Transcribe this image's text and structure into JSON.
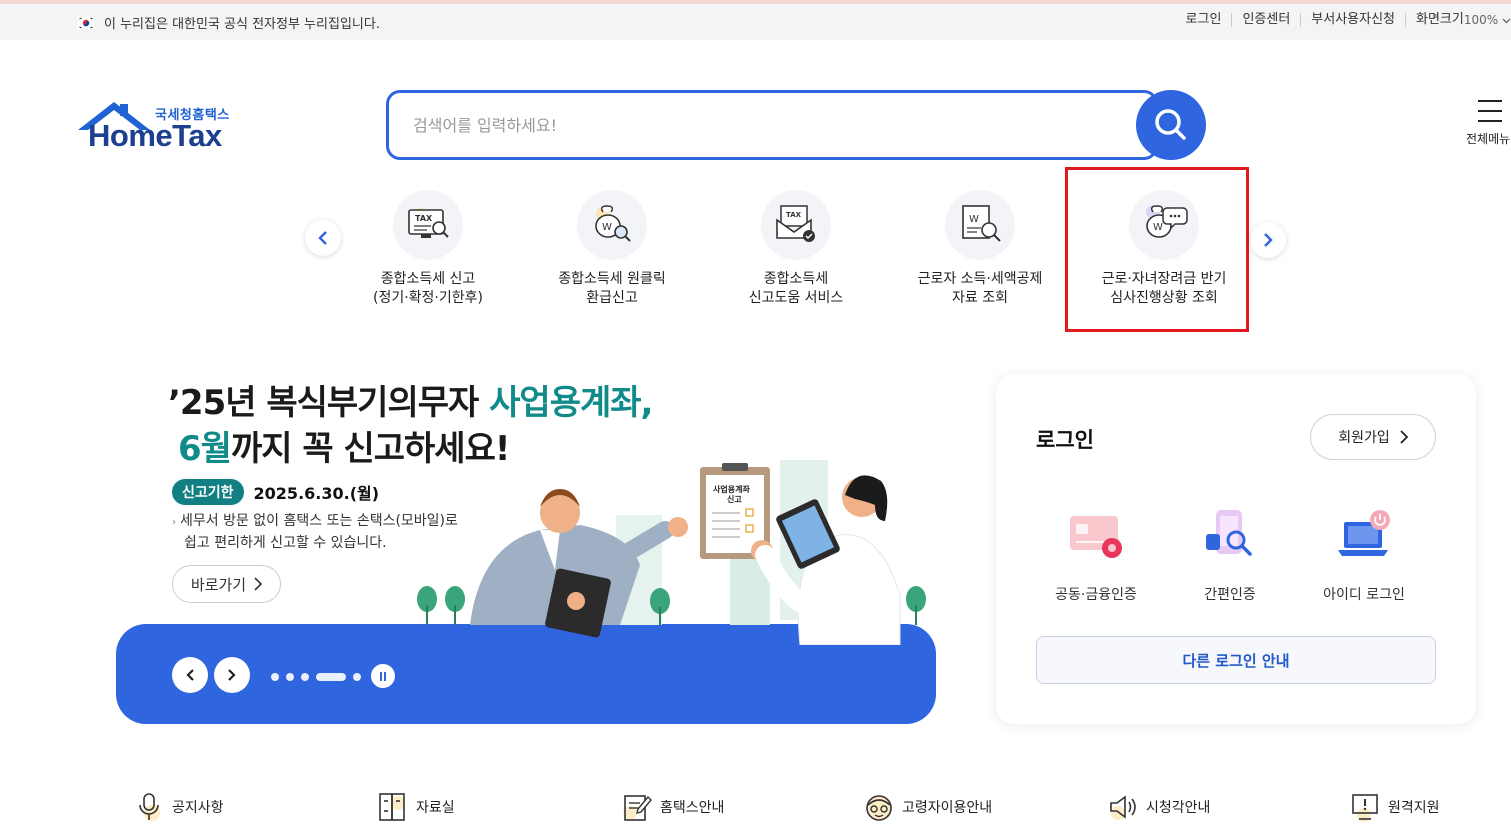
{
  "gov_banner": {
    "flag_icon": "korean-flag-icon",
    "text": "이 누리집은 대한민국 공식 전자정부 누리집입니다.",
    "links": [
      "로그인",
      "인증센터",
      "부서사용자신청",
      "화면크기"
    ],
    "zoom": "100%"
  },
  "logo": {
    "sub": "국세청홈택스",
    "main": "HomeTax"
  },
  "search": {
    "placeholder": "검색어를 입력하세요!",
    "button_icon": "search-icon"
  },
  "all_menu": {
    "label": "전체메뉴"
  },
  "quick_menu": {
    "items": [
      {
        "label": "종합소득세 신고\n(정기·확정·기한후)",
        "icon": "tax-monitor-icon"
      },
      {
        "label": "종합소득세 원클릭\n환급신고",
        "icon": "money-bag-search-icon"
      },
      {
        "label": "종합소득세\n신고도움 서비스",
        "icon": "tax-envelope-check-icon"
      },
      {
        "label": "근로자 소득·세액공제\n자료 조회",
        "icon": "document-search-icon"
      },
      {
        "label": "근로·자녀장려금 반기\n심사진행상황 조회",
        "icon": "money-bag-chat-icon"
      }
    ],
    "highlighted_index": 4
  },
  "banner": {
    "title_part1": "’25년 복식부기의무자 ",
    "title_accent1": "사업용계좌,",
    "title_accent2": "6월",
    "title_part2": "까지 꼭 신고하세요!",
    "badge": "신고기한",
    "date": "2025.6.30.(월)",
    "desc_line1": "세무서 방문 없이 홈택스 또는 손택스(모바일)로",
    "desc_line2": "쉽고 편리하게 신고할 수 있습니다.",
    "go_label": "바로가기",
    "clipboard_text": "사업용계좌\n신고",
    "slide_count": 6,
    "active_slide": 3
  },
  "login": {
    "title": "로그인",
    "join_label": "회원가입",
    "options": [
      {
        "label": "공동·금융인증",
        "icon": "certificate-card-icon"
      },
      {
        "label": "간편인증",
        "icon": "phone-search-icon"
      },
      {
        "label": "아이디 로그인",
        "icon": "laptop-power-icon"
      }
    ],
    "other_login": "다른 로그인 안내"
  },
  "bottom_nav": [
    {
      "label": "공지사항",
      "icon": "microphone-icon"
    },
    {
      "label": "자료실",
      "icon": "file-cabinet-icon"
    },
    {
      "label": "홈택스안내",
      "icon": "notepad-pen-icon"
    },
    {
      "label": "고령자이용안내",
      "icon": "elderly-face-icon"
    },
    {
      "label": "시청각안내",
      "icon": "speaker-icon"
    },
    {
      "label": "원격지원",
      "icon": "monitor-alert-icon"
    }
  ],
  "colors": {
    "primary": "#2f66e0",
    "accent_teal": "#118a8a",
    "highlight": "#e0191e",
    "navy": "#1c3f8f"
  }
}
